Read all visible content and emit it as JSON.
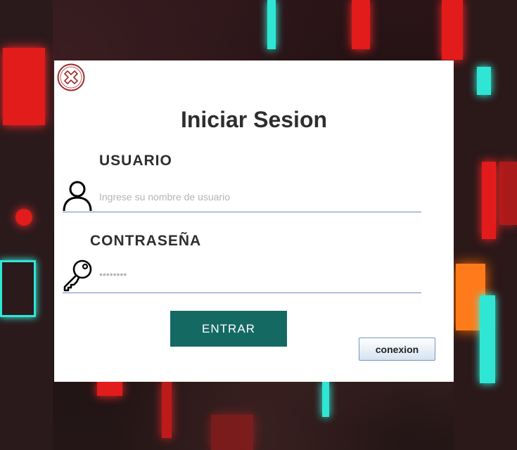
{
  "login": {
    "title": "Iniciar Sesion",
    "user_label": "USUARIO",
    "user_placeholder": "Ingrese su nombre de usuario",
    "password_label": "CONTRASEÑA",
    "password_mask": "••••••••",
    "enter_button": "ENTRAR",
    "connection_button": "conexion"
  },
  "icons": {
    "close": "close-icon",
    "user": "user-icon",
    "password": "key-icon"
  },
  "colors": {
    "enter_button_bg": "#156963",
    "field_underline": "#6f8db9",
    "close_icon": "#9b2d2d",
    "text": "#2e2e2e"
  }
}
